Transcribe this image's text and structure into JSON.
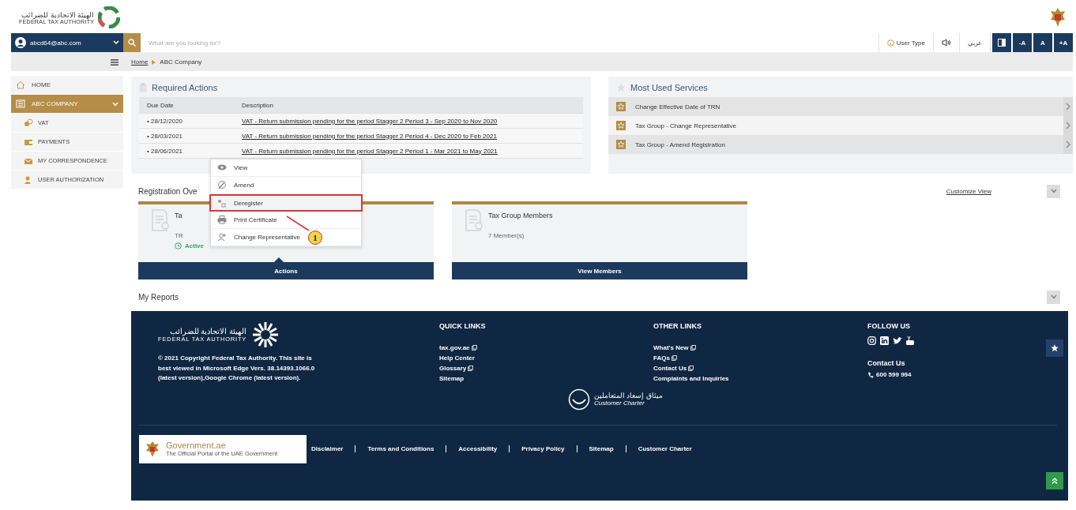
{
  "header": {
    "logo_arabic": "الهيئة الاتحادية للضرائب",
    "logo_english": "FEDERAL TAX AUTHORITY"
  },
  "toolbar": {
    "user": "abcd64@abc.com",
    "search": {
      "placeholder": "What are you looking for?"
    },
    "user_type": "User Type",
    "language": "عربي",
    "font_buttons": [
      "-A",
      "A",
      "+A"
    ]
  },
  "sidebar": {
    "items": [
      {
        "label": "HOME",
        "selected": false
      },
      {
        "label": "ABC COMPANY",
        "selected": true,
        "expanded": true,
        "children": [
          {
            "label": "VAT"
          },
          {
            "label": "PAYMENTS"
          },
          {
            "label": "MY CORRESPONDENCE"
          },
          {
            "label": "USER AUTHORIZATION"
          }
        ]
      }
    ]
  },
  "breadcrumb": [
    {
      "label": "Home"
    },
    {
      "label": "ABC Company"
    }
  ],
  "required_actions": {
    "title": "Required Actions",
    "columns": [
      "Due Date",
      "Description"
    ],
    "rows": [
      {
        "due_date": "• 28/12/2020",
        "description": "VAT - Return submission pending for the period Stagger 2 Period 3 - Sep 2020 to Nov 2020"
      },
      {
        "due_date": "• 28/03/2021",
        "description": "VAT - Return submission pending for the period Stagger 2 Period 4 - Dec 2020 to Feb 2021"
      },
      {
        "due_date": "• 28/06/2021",
        "description": "VAT - Return submission pending for the period Stagger 2 Period 1 - Mar 2021 to May 2021"
      }
    ]
  },
  "most_used_services": {
    "title": "Most Used Services",
    "items": [
      {
        "label": "Change Effective Date of TRN"
      },
      {
        "label": "Tax Group - Change Representative"
      },
      {
        "label": "Tax Group - Amend Registration"
      }
    ]
  },
  "registration_overview": {
    "title": "Registration Ove",
    "customize": "Customize View",
    "cards": [
      {
        "title": "Ta",
        "detail": "TR",
        "status": "Active",
        "button": "Actions",
        "menu_open": true
      },
      {
        "title": "Tax Group Members",
        "detail": "7 Member(s)",
        "button": "View Members",
        "menu_open": false
      }
    ]
  },
  "action_menu": {
    "items": [
      {
        "label": "View",
        "highlighted": false
      },
      {
        "label": "Amend",
        "highlighted": false
      },
      {
        "label": "Deregister",
        "highlighted": true
      },
      {
        "label": "Print Certificate",
        "highlighted": false
      },
      {
        "label": "Change Representative",
        "highlighted": false
      }
    ],
    "callout": "1"
  },
  "my_reports": {
    "title": "My Reports"
  },
  "footer": {
    "logo_arabic": "الهيئة الاتحادية للضرائب",
    "logo_english": "FEDERAL TAX AUTHORITY",
    "copyright": "© 2021 Copyright Federal Tax Authority. This site is best viewed in Microsoft Edge Vers. 38.14393.1066.0 (latest version),Google Chrome (latest version).",
    "columns": [
      {
        "title": "QUICK LINKS",
        "links": [
          {
            "label": "tax.gov.ae",
            "external": true
          },
          {
            "label": "Help Center",
            "external": false
          },
          {
            "label": "Glossary",
            "external": true
          },
          {
            "label": "Sitemap",
            "external": false
          }
        ]
      },
      {
        "title": "OTHER LINKS",
        "links": [
          {
            "label": "What's New",
            "external": true
          },
          {
            "label": "FAQs",
            "external": true
          },
          {
            "label": "Contact Us",
            "external": true
          },
          {
            "label": "Complaints and Inquiries",
            "external": false
          }
        ]
      }
    ],
    "follow_title": "FOLLOW US",
    "contact_title": "Contact Us",
    "phone": "600 599 994",
    "charter_arabic": "ميثاق إسعاد المتعاملين",
    "charter_english": "Customer Charter",
    "gov_title": "Government.ae",
    "gov_tagline": "The Official Portal of the UAE Government",
    "bottom_links": [
      "Disclaimer",
      "Terms and Conditions",
      "Accessibility",
      "Privacy Policy",
      "Sitemap",
      "Customer Charter"
    ]
  }
}
